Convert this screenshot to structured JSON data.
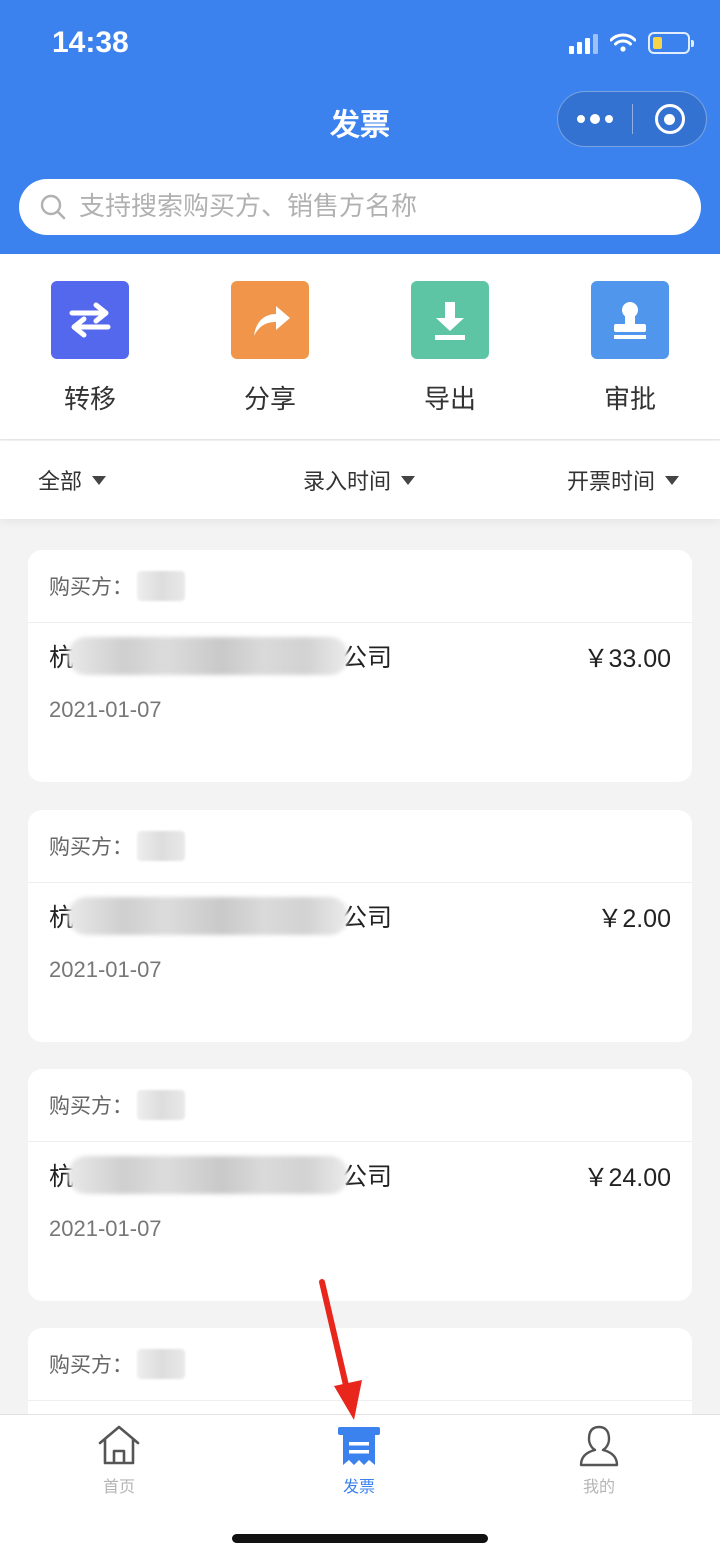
{
  "status_bar": {
    "time": "14:38"
  },
  "header": {
    "title": "发票"
  },
  "search": {
    "placeholder": "支持搜索购买方、销售方名称"
  },
  "actions": [
    {
      "label": "转移",
      "icon": "transfer-icon",
      "color": "#5468ee"
    },
    {
      "label": "分享",
      "icon": "share-icon",
      "color": "#f0954a"
    },
    {
      "label": "导出",
      "icon": "download-icon",
      "color": "#5dc5a4"
    },
    {
      "label": "审批",
      "icon": "approve-icon",
      "color": "#4f96ec"
    }
  ],
  "filters": [
    {
      "label": "全部"
    },
    {
      "label": "录入时间"
    },
    {
      "label": "开票时间"
    }
  ],
  "invoices": [
    {
      "buyer_label": "购买方：",
      "seller_prefix": "杭",
      "seller_suffix": "公司",
      "amount": "￥33.00",
      "date": "2021-01-07"
    },
    {
      "buyer_label": "购买方：",
      "seller_prefix": "杭",
      "seller_suffix": "公司",
      "amount": "￥2.00",
      "date": "2021-01-07"
    },
    {
      "buyer_label": "购买方：",
      "seller_prefix": "杭",
      "seller_suffix": "公司",
      "amount": "￥24.00",
      "date": "2021-01-07"
    },
    {
      "buyer_label": "购买方："
    }
  ],
  "tabbar": [
    {
      "label": "首页",
      "icon": "home-icon"
    },
    {
      "label": "发票",
      "icon": "invoice-icon",
      "active": true
    },
    {
      "label": "我的",
      "icon": "user-icon"
    }
  ],
  "colors": {
    "brand": "#3b82ee",
    "annotation": "#e8261c"
  }
}
